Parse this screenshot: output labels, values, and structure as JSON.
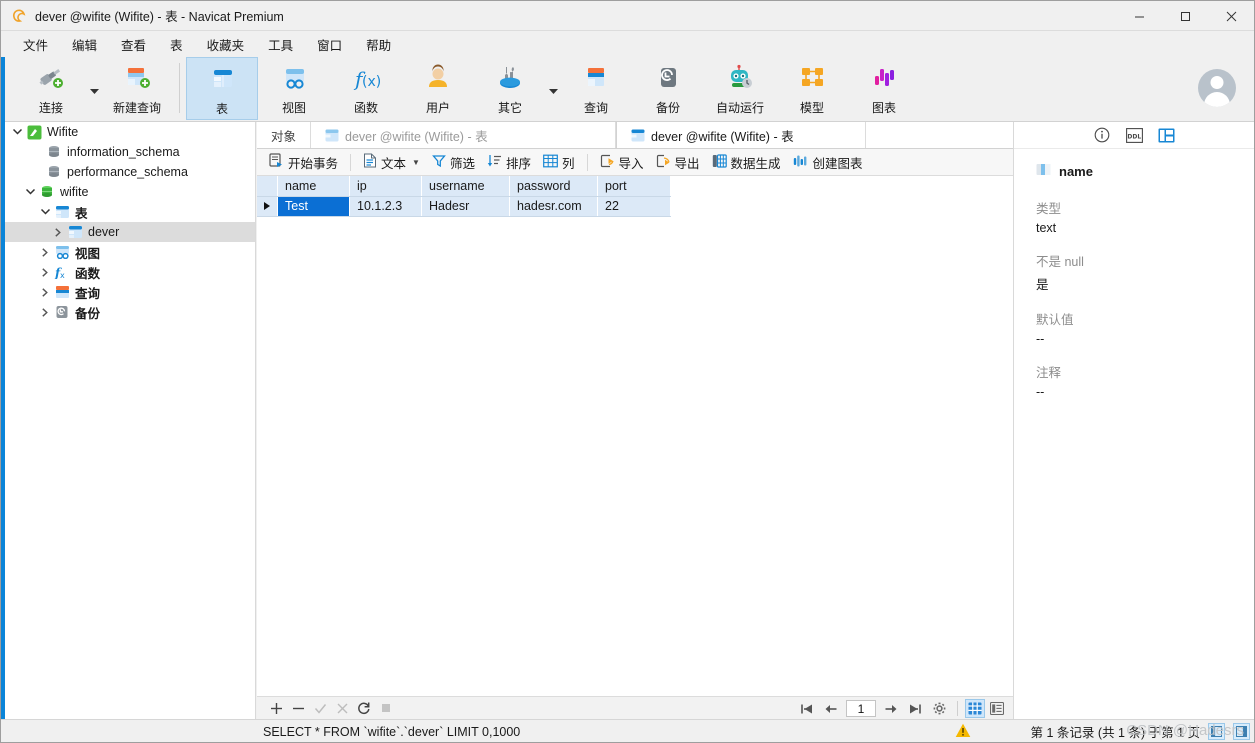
{
  "window": {
    "title": "dever @wifite (Wifite) - 表 - Navicat Premium",
    "app_icon": "navicat-logo-icon",
    "controls": {
      "minimize": "–",
      "maximize": "□",
      "close": "✕"
    }
  },
  "menubar": {
    "items": [
      {
        "label": "文件",
        "name": "menu-file"
      },
      {
        "label": "编辑",
        "name": "menu-edit"
      },
      {
        "label": "查看",
        "name": "menu-view"
      },
      {
        "label": "表",
        "name": "menu-table"
      },
      {
        "label": "收藏夹",
        "name": "menu-favorites"
      },
      {
        "label": "工具",
        "name": "menu-tools"
      },
      {
        "label": "窗口",
        "name": "menu-window"
      },
      {
        "label": "帮助",
        "name": "menu-help"
      }
    ]
  },
  "ribbon": {
    "items": [
      {
        "label": "连接",
        "icon": "connection-icon",
        "selected": false,
        "caret": true
      },
      {
        "label": "新建查询",
        "icon": "new-query-icon",
        "selected": false,
        "caret": false
      },
      {
        "label": "表",
        "icon": "table-icon",
        "selected": true,
        "caret": false
      },
      {
        "label": "视图",
        "icon": "view-icon",
        "selected": false,
        "caret": false
      },
      {
        "label": "函数",
        "icon": "function-icon",
        "selected": false,
        "caret": false
      },
      {
        "label": "用户",
        "icon": "user-icon",
        "selected": false,
        "caret": false
      },
      {
        "label": "其它",
        "icon": "other-tools-icon",
        "selected": false,
        "caret": true
      },
      {
        "label": "查询",
        "icon": "query-icon",
        "selected": false,
        "caret": false
      },
      {
        "label": "备份",
        "icon": "backup-icon",
        "selected": false,
        "caret": false
      },
      {
        "label": "自动运行",
        "icon": "automation-icon",
        "selected": false,
        "caret": false
      },
      {
        "label": "模型",
        "icon": "model-icon",
        "selected": false,
        "caret": false
      },
      {
        "label": "图表",
        "icon": "chart-icon",
        "selected": false,
        "caret": false
      }
    ],
    "avatar": "user-avatar"
  },
  "sidebar": {
    "nodes": [
      {
        "label": "Wifite",
        "indent": 0,
        "twisty": "down",
        "icon": "navicat-connection-icon",
        "selected": false,
        "bold": false
      },
      {
        "label": "information_schema",
        "indent": 1,
        "twisty": "none",
        "icon": "database-gray-icon",
        "selected": false,
        "bold": false
      },
      {
        "label": "performance_schema",
        "indent": 1,
        "twisty": "none",
        "icon": "database-gray-icon",
        "selected": false,
        "bold": false
      },
      {
        "label": "wifite",
        "indent": 1,
        "twisty": "down",
        "icon": "database-green-icon",
        "selected": false,
        "bold": false
      },
      {
        "label": "表",
        "indent": 2,
        "twisty": "down",
        "icon": "table-icon",
        "selected": false,
        "bold": true
      },
      {
        "label": "dever",
        "indent": 3,
        "twisty": "right",
        "icon": "table-icon",
        "selected": true,
        "bold": false
      },
      {
        "label": "视图",
        "indent": 2,
        "twisty": "right",
        "icon": "view-icon",
        "selected": false,
        "bold": true
      },
      {
        "label": "函数",
        "indent": 2,
        "twisty": "right",
        "icon": "function-icon",
        "selected": false,
        "bold": true
      },
      {
        "label": "查询",
        "indent": 2,
        "twisty": "right",
        "icon": "query-icon",
        "selected": false,
        "bold": true
      },
      {
        "label": "备份",
        "indent": 2,
        "twisty": "right",
        "icon": "backup-icon",
        "selected": false,
        "bold": true
      }
    ]
  },
  "tabs": {
    "objects_label": "对象",
    "items": [
      {
        "label": "dever @wifite (Wifite) - 表",
        "icon": "table-icon",
        "active": false
      },
      {
        "label": "dever @wifite (Wifite) - 表",
        "icon": "table-icon",
        "active": true
      }
    ]
  },
  "data_toolbar": {
    "buttons": [
      {
        "label": "开始事务",
        "icon": "begin-transaction-icon",
        "caret": false
      },
      {
        "label": "文本",
        "icon": "text-icon",
        "caret": true
      },
      {
        "label": "筛选",
        "icon": "filter-icon",
        "caret": false
      },
      {
        "label": "排序",
        "icon": "sort-icon",
        "caret": false
      },
      {
        "label": "列",
        "icon": "columns-icon",
        "caret": false
      },
      {
        "label": "导入",
        "icon": "import-icon",
        "caret": false
      },
      {
        "label": "导出",
        "icon": "export-icon",
        "caret": false
      },
      {
        "label": "数据生成",
        "icon": "data-generation-icon",
        "caret": false
      },
      {
        "label": "创建图表",
        "icon": "create-chart-icon",
        "caret": false
      }
    ]
  },
  "grid": {
    "columns": [
      "name",
      "ip",
      "username",
      "password",
      "port"
    ],
    "rows": [
      {
        "cells": [
          "Test",
          "10.1.2.3",
          "Hadesr",
          "hadesr.com",
          "22"
        ],
        "selected_index": 0,
        "current": true
      }
    ]
  },
  "right_panel": {
    "header_buttons": [
      {
        "icon": "info-circle-icon",
        "active": false
      },
      {
        "icon": "ddl-icon",
        "active": false
      },
      {
        "icon": "grid-panel-icon",
        "active": true
      }
    ],
    "field_icon": "column-icon",
    "field_name": "name",
    "properties": [
      {
        "key": "类型",
        "value": "text"
      },
      {
        "key": "不是 null",
        "value": "是"
      },
      {
        "key": "默认值",
        "value": "--"
      },
      {
        "key": "注释",
        "value": "--"
      }
    ]
  },
  "record_nav": {
    "left_buttons": [
      {
        "icon": "add-record-icon",
        "glyph": "+",
        "disabled": false
      },
      {
        "icon": "delete-record-icon",
        "glyph": "−",
        "disabled": false
      },
      {
        "icon": "apply-change-icon",
        "glyph": "✓",
        "disabled": true
      },
      {
        "icon": "cancel-change-icon",
        "glyph": "✕",
        "disabled": true
      },
      {
        "icon": "refresh-icon",
        "glyph": "⟳",
        "disabled": false
      },
      {
        "icon": "stop-icon",
        "glyph": "■",
        "disabled": true
      }
    ],
    "pager": {
      "first": "first-record-icon",
      "prev": "prev-record-icon",
      "page_value": "1",
      "next": "next-record-icon",
      "last": "last-record-icon",
      "settings": "pager-settings-icon"
    },
    "view_toggles": [
      {
        "icon": "grid-view-icon",
        "active": true
      },
      {
        "icon": "form-view-icon",
        "active": false
      }
    ]
  },
  "statusbar": {
    "sql": "SELECT * FROM `wifite`.`dever` LIMIT 0,1000",
    "warning_icon": "warning-triangle-icon",
    "record_info": "第 1 条记录 (共 1 条) 于第 1 页",
    "right_buttons": [
      {
        "icon": "status-panel-left-icon"
      },
      {
        "icon": "status-panel-right-icon"
      }
    ]
  },
  "watermark": {
    "text": "CSDN @Hadesrs"
  },
  "colors": {
    "accent_blue": "#0a84d8",
    "selection_blue": "#0b6fd4",
    "grid_row_blue": "#dce9f7",
    "ribbon_selected": "#cce3f5",
    "chrome_gray": "#f0f0f0"
  }
}
